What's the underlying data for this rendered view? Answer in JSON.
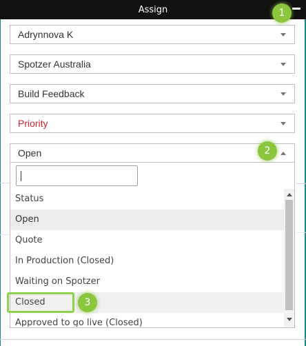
{
  "window": {
    "title": "Assign"
  },
  "fields": {
    "assignee": "Adrynnova K",
    "client": "Spotzer Australia",
    "category": "Build Feedback",
    "priority_placeholder": "Priority",
    "status": "Open"
  },
  "dropdown": {
    "search_value": "",
    "options": [
      {
        "label": "Status"
      },
      {
        "label": "Open"
      },
      {
        "label": "Quote"
      },
      {
        "label": "In Production (Closed)"
      },
      {
        "label": "Waiting on Spotzer"
      },
      {
        "label": "Closed"
      },
      {
        "label": "Approved to go live (Closed)"
      }
    ]
  },
  "annotations": [
    "1",
    "2",
    "3"
  ],
  "colors": {
    "accent": "#8cc63f",
    "panel_border": "#1b8a90",
    "priority_text": "#d0242a"
  }
}
